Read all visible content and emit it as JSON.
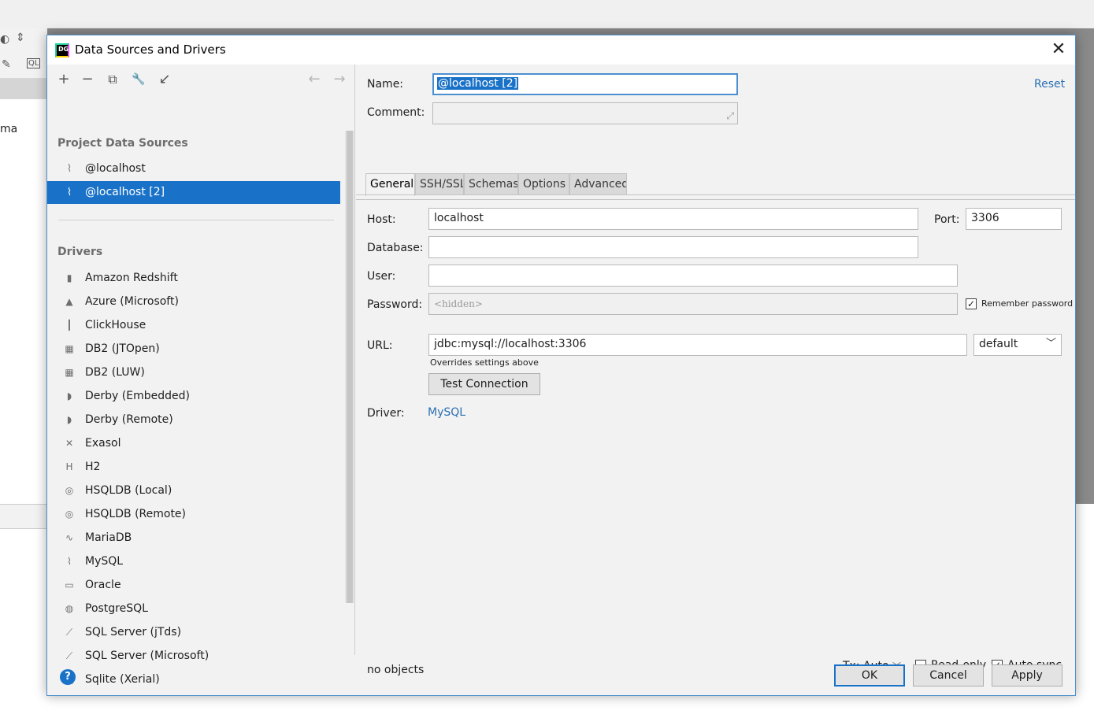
{
  "background": {
    "partial_text": "ma"
  },
  "dialog": {
    "title": "Data Sources and Drivers",
    "app_icon_text": "DG"
  },
  "toolbar": {
    "add": "+",
    "remove": "−",
    "copy": "⧉",
    "settings": "🔧",
    "import": "↙",
    "back": "←",
    "forward": "→"
  },
  "project": {
    "header": "Project Data Sources",
    "items": [
      {
        "label": "@localhost",
        "icon": "mysql-dolphin-icon"
      },
      {
        "label": "@localhost [2]",
        "icon": "mysql-dolphin-icon"
      }
    ]
  },
  "drivers": {
    "header": "Drivers",
    "items": [
      {
        "label": "Amazon Redshift",
        "icon": "redshift-icon"
      },
      {
        "label": "Azure (Microsoft)",
        "icon": "azure-icon"
      },
      {
        "label": "ClickHouse",
        "icon": "clickhouse-icon"
      },
      {
        "label": "DB2 (JTOpen)",
        "icon": "db2-icon"
      },
      {
        "label": "DB2 (LUW)",
        "icon": "db2-icon"
      },
      {
        "label": "Derby (Embedded)",
        "icon": "derby-icon"
      },
      {
        "label": "Derby (Remote)",
        "icon": "derby-icon"
      },
      {
        "label": "Exasol",
        "icon": "exasol-icon"
      },
      {
        "label": "H2",
        "icon": "h2-icon"
      },
      {
        "label": "HSQLDB (Local)",
        "icon": "hsqldb-icon"
      },
      {
        "label": "HSQLDB (Remote)",
        "icon": "hsqldb-icon"
      },
      {
        "label": "MariaDB",
        "icon": "mariadb-icon"
      },
      {
        "label": "MySQL",
        "icon": "mysql-dolphin-icon"
      },
      {
        "label": "Oracle",
        "icon": "oracle-icon"
      },
      {
        "label": "PostgreSQL",
        "icon": "postgresql-icon"
      },
      {
        "label": "SQL Server (jTds)",
        "icon": "sqlserver-icon"
      },
      {
        "label": "SQL Server (Microsoft)",
        "icon": "sqlserver-icon"
      },
      {
        "label": "Sqlite (Xerial)",
        "icon": "sqlite-icon"
      }
    ]
  },
  "form": {
    "name_label": "Name:",
    "name_value": "@localhost [2]",
    "comment_label": "Comment:",
    "comment_value": "",
    "reset": "Reset",
    "tabs": [
      "General",
      "SSH/SSL",
      "Schemas",
      "Options",
      "Advanced"
    ],
    "active_tab": "General",
    "host_label": "Host:",
    "host_value": "localhost",
    "port_label": "Port:",
    "port_value": "3306",
    "database_label": "Database:",
    "database_value": "",
    "user_label": "User:",
    "user_value": "",
    "password_label": "Password:",
    "password_placeholder": "<hidden>",
    "remember_password": "Remember password",
    "remember_checked": true,
    "url_label": "URL:",
    "url_value": "jdbc:mysql://localhost:3306",
    "url_mode": "default",
    "overrides_note": "Overrides settings above",
    "test_connection": "Test Connection",
    "driver_label": "Driver:",
    "driver_value": "MySQL"
  },
  "status": {
    "objects": "no objects",
    "tx": "Tx: Auto",
    "read_only": "Read-only",
    "read_only_checked": false,
    "auto_sync": "Auto sync",
    "auto_sync_checked": true
  },
  "buttons": {
    "ok": "OK",
    "cancel": "Cancel",
    "apply": "Apply",
    "help": "?"
  },
  "colors": {
    "accent": "#1a72c8",
    "link": "#2c6fb3",
    "selection": "#1a72c8"
  }
}
